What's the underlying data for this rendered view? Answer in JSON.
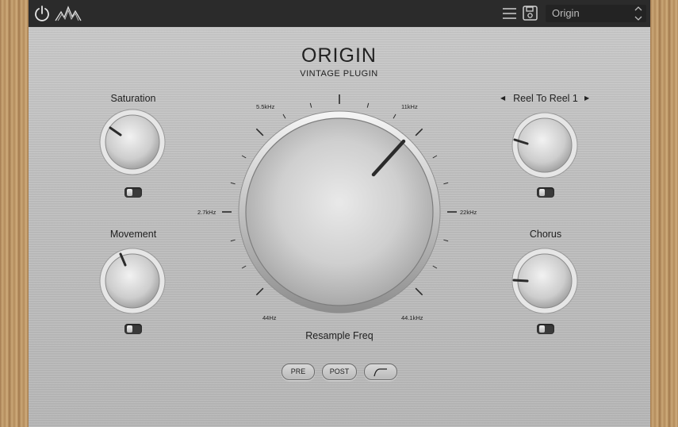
{
  "header": {
    "power_icon": "power-icon",
    "logo_icon": "waveform-logo-icon",
    "menu_icon": "hamburger-menu-icon",
    "save_icon": "save-icon",
    "preset_name": "Origin"
  },
  "plugin": {
    "title": "ORIGIN",
    "subtitle": "VINTAGE PLUGIN"
  },
  "knobs": {
    "saturation": {
      "label": "Saturation"
    },
    "movement": {
      "label": "Movement"
    },
    "reel": {
      "label": "Reel To Reel 1"
    },
    "chorus": {
      "label": "Chorus"
    },
    "resample": {
      "label": "Resample Freq"
    }
  },
  "freq_labels": {
    "f44": "44Hz",
    "f2_7k": "2.7kHz",
    "f5_5k": "5.5kHz",
    "f11k": "11kHz",
    "f22k": "22kHz",
    "f44_1k": "44.1kHz"
  },
  "buttons": {
    "pre": "PRE",
    "post": "POST",
    "filter_icon": "filter-curve-icon"
  },
  "colors": {
    "topbar": "#2b2b2b",
    "panel": "#bdbdbd",
    "wood": "#b88f5f"
  }
}
